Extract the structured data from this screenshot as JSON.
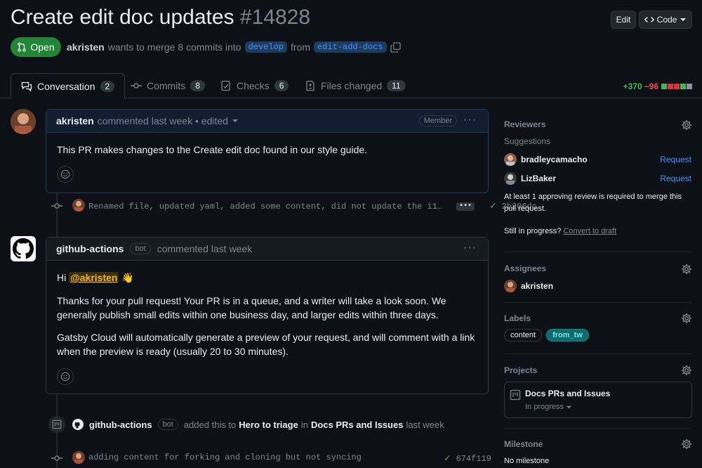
{
  "pr": {
    "title": "Create edit doc updates",
    "number": "#14828",
    "state": "Open",
    "author": "akristen",
    "merge_text": "wants to merge 8 commits into",
    "base_branch": "develop",
    "from_text": "from",
    "head_branch": "edit-add-docs"
  },
  "header_buttons": {
    "edit": "Edit",
    "code": "Code"
  },
  "tabs": [
    {
      "label": "Conversation",
      "count": "2"
    },
    {
      "label": "Commits",
      "count": "8"
    },
    {
      "label": "Checks",
      "count": "6"
    },
    {
      "label": "Files changed",
      "count": "11"
    }
  ],
  "diffstat": {
    "additions": "+370",
    "deletions": "−96"
  },
  "timeline": {
    "comment1": {
      "author": "akristen",
      "meta": "commented last week • edited",
      "role": "Member",
      "body": "This PR makes changes to the Create edit doc found in our style guide."
    },
    "commit1": {
      "message": "Renamed file, updated yaml, added some content, did not update the i1…",
      "more": "•••",
      "sha": "2b206dc"
    },
    "comment2": {
      "author": "github-actions",
      "bot": "bot",
      "meta": "commented last week",
      "greeting": "Hi",
      "mention": "@akristen",
      "wave": "👋",
      "p1": "Thanks for your pull request! Your PR is in a queue, and a writer will take a look soon. We generally publish small edits within one business day, and larger edits within three days.",
      "p2": "Gatsby Cloud will automatically generate a preview of your request, and will comment with a link when the preview is ready (usually 20 to 30 minutes)."
    },
    "event": {
      "actor": "github-actions",
      "bot": "bot",
      "text1": "added this to",
      "column": "Hero to triage",
      "text2": "in",
      "project": "Docs PRs and Issues",
      "time": "last week"
    },
    "commit2": {
      "message": "adding content for forking and cloning but not syncing",
      "sha": "674f119"
    }
  },
  "sidebar": {
    "reviewers": {
      "heading": "Reviewers",
      "suggestions": "Suggestions",
      "users": [
        {
          "name": "bradleycamacho",
          "action": "Request"
        },
        {
          "name": "LizBaker",
          "action": "Request"
        }
      ],
      "note": "At least 1 approving review is required to merge this pull request.",
      "progress": "Still in progress?",
      "draft_link": "Convert to draft"
    },
    "assignees": {
      "heading": "Assignees",
      "user": "akristen"
    },
    "labels": {
      "heading": "Labels",
      "items": [
        {
          "name": "content",
          "color": "#30363d"
        },
        {
          "name": "from_tw",
          "color": "#0e6b6b"
        }
      ]
    },
    "projects": {
      "heading": "Projects",
      "name": "Docs PRs and Issues",
      "status": "In progress"
    },
    "milestone": {
      "heading": "Milestone",
      "value": "No milestone"
    }
  }
}
